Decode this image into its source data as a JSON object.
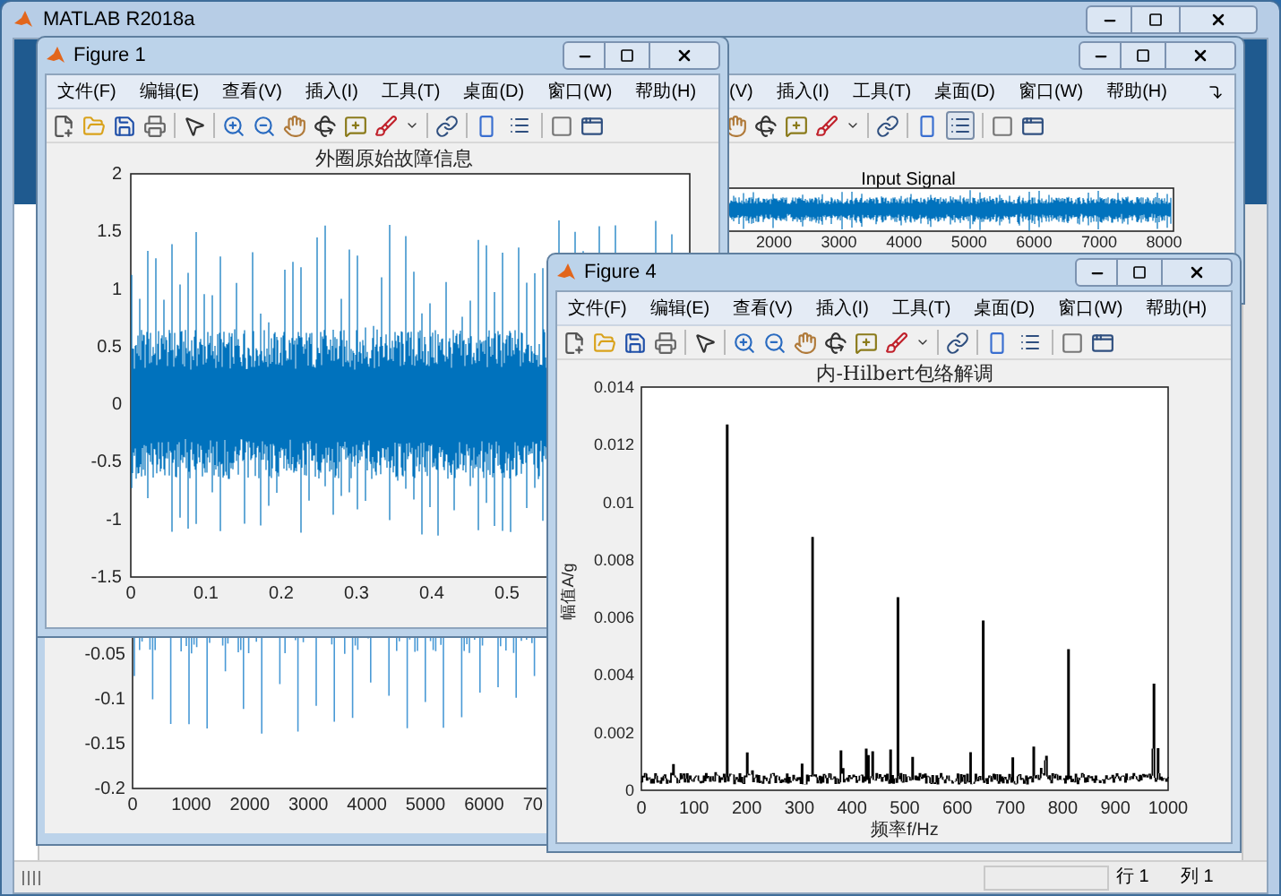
{
  "main_window": {
    "title": "MATLAB R2018a",
    "status_bar": {
      "row": "行 1",
      "column": "列 1"
    }
  },
  "figure_top_right": {
    "menu": [
      "(V)",
      "插入(I)",
      "工具(T)",
      "桌面(D)",
      "窗口(W)",
      "帮助(H)"
    ],
    "legend_on": true,
    "plot": {
      "title": "Input Signal",
      "xticks": [
        "2000",
        "3000",
        "4000",
        "5000",
        "6000",
        "7000",
        "8000"
      ]
    }
  },
  "figure_bottom_left": {
    "plot": {
      "yticks": [
        "-0.05",
        "-0.1",
        "-0.15",
        "-0.2"
      ],
      "xticks": [
        "0",
        "1000",
        "2000",
        "3000",
        "4000",
        "5000",
        "6000",
        "70"
      ]
    }
  },
  "figure_1": {
    "title": "Figure 1",
    "menu": [
      "文件(F)",
      "编辑(E)",
      "查看(V)",
      "插入(I)",
      "工具(T)",
      "桌面(D)",
      "窗口(W)",
      "帮助(H)"
    ],
    "legend_on": false,
    "plot": {
      "title": "外圈原始故障信息",
      "yticks": [
        "2",
        "1.5",
        "1",
        "0.5",
        "0",
        "-0.5",
        "-1",
        "-1.5"
      ],
      "xticks": [
        "0",
        "0.1",
        "0.2",
        "0.3",
        "0.4",
        "0.5"
      ]
    }
  },
  "figure_4": {
    "title": "Figure 4",
    "menu": [
      "文件(F)",
      "编辑(E)",
      "查看(V)",
      "插入(I)",
      "工具(T)",
      "桌面(D)",
      "窗口(W)",
      "帮助(H)"
    ],
    "legend_on": false,
    "plot": {
      "title": "内-Hilbert包络解调",
      "ylabel": "幅值A/g",
      "xlabel": "频率f/Hz",
      "yticks": [
        "0.014",
        "0.012",
        "0.01",
        "0.008",
        "0.006",
        "0.004",
        "0.002",
        "0"
      ],
      "xticks": [
        "0",
        "100",
        "200",
        "300",
        "400",
        "500",
        "600",
        "700",
        "800",
        "900",
        "1000"
      ]
    }
  }
}
